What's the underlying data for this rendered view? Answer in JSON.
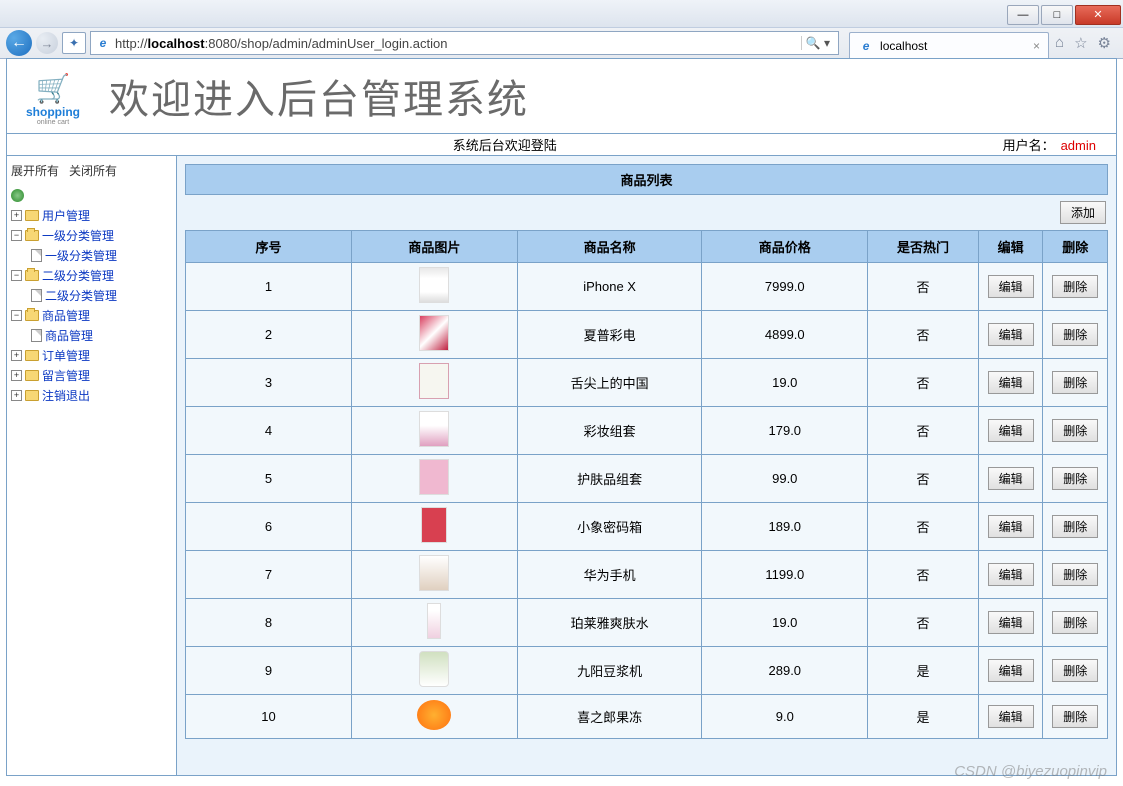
{
  "browser": {
    "url_prefix": "http://",
    "url_host": "localhost",
    "url_rest": ":8080/shop/admin/adminUser_login.action",
    "tab_title": "localhost"
  },
  "header": {
    "logo_text": "shopping",
    "logo_sub": "online cart",
    "title": "欢迎进入后台管理系统"
  },
  "welcome": {
    "center": "系统后台欢迎登陆",
    "user_label": "用户名：",
    "user_name": "admin"
  },
  "sidebar": {
    "expand_all": "展开所有",
    "collapse_all": "关闭所有",
    "nodes": [
      {
        "type": "root",
        "expander": "",
        "icon": "globe",
        "label": ""
      },
      {
        "type": "folder",
        "expander": "+",
        "icon": "folder",
        "label": "用户管理"
      },
      {
        "type": "folder",
        "expander": "−",
        "icon": "folder-open",
        "label": "一级分类管理"
      },
      {
        "type": "leaf",
        "expander": "",
        "icon": "page",
        "label": "一级分类管理"
      },
      {
        "type": "folder",
        "expander": "−",
        "icon": "folder-open",
        "label": "二级分类管理"
      },
      {
        "type": "leaf",
        "expander": "",
        "icon": "page",
        "label": "二级分类管理"
      },
      {
        "type": "folder",
        "expander": "−",
        "icon": "folder-open",
        "label": "商品管理"
      },
      {
        "type": "leaf",
        "expander": "",
        "icon": "page",
        "label": "商品管理"
      },
      {
        "type": "folder",
        "expander": "+",
        "icon": "folder",
        "label": "订单管理"
      },
      {
        "type": "folder",
        "expander": "+",
        "icon": "folder",
        "label": "留言管理"
      },
      {
        "type": "folder",
        "expander": "+",
        "icon": "folder",
        "label": "注销退出"
      }
    ]
  },
  "list": {
    "title": "商品列表",
    "add_btn": "添加",
    "columns": [
      "序号",
      "商品图片",
      "商品名称",
      "商品价格",
      "是否热门",
      "编辑",
      "删除"
    ],
    "edit_btn": "编辑",
    "delete_btn": "删除",
    "rows": [
      {
        "no": "1",
        "thumb": "t1",
        "name": "iPhone X",
        "price": "7999.0",
        "hot": "否"
      },
      {
        "no": "2",
        "thumb": "t2",
        "name": "夏普彩电",
        "price": "4899.0",
        "hot": "否"
      },
      {
        "no": "3",
        "thumb": "t3",
        "name": "舌尖上的中国",
        "price": "19.0",
        "hot": "否"
      },
      {
        "no": "4",
        "thumb": "t4",
        "name": "彩妆组套",
        "price": "179.0",
        "hot": "否"
      },
      {
        "no": "5",
        "thumb": "t5",
        "name": "护肤品组套",
        "price": "99.0",
        "hot": "否"
      },
      {
        "no": "6",
        "thumb": "t6",
        "name": "小象密码箱",
        "price": "189.0",
        "hot": "否"
      },
      {
        "no": "7",
        "thumb": "t7",
        "name": "华为手机",
        "price": "1199.0",
        "hot": "否"
      },
      {
        "no": "8",
        "thumb": "t8",
        "name": "珀莱雅爽肤水",
        "price": "19.0",
        "hot": "否"
      },
      {
        "no": "9",
        "thumb": "t9",
        "name": "九阳豆浆机",
        "price": "289.0",
        "hot": "是"
      },
      {
        "no": "10",
        "thumb": "t10",
        "name": "喜之郎果冻",
        "price": "9.0",
        "hot": "是"
      }
    ]
  },
  "watermark": "CSDN @biyezuopinvip"
}
